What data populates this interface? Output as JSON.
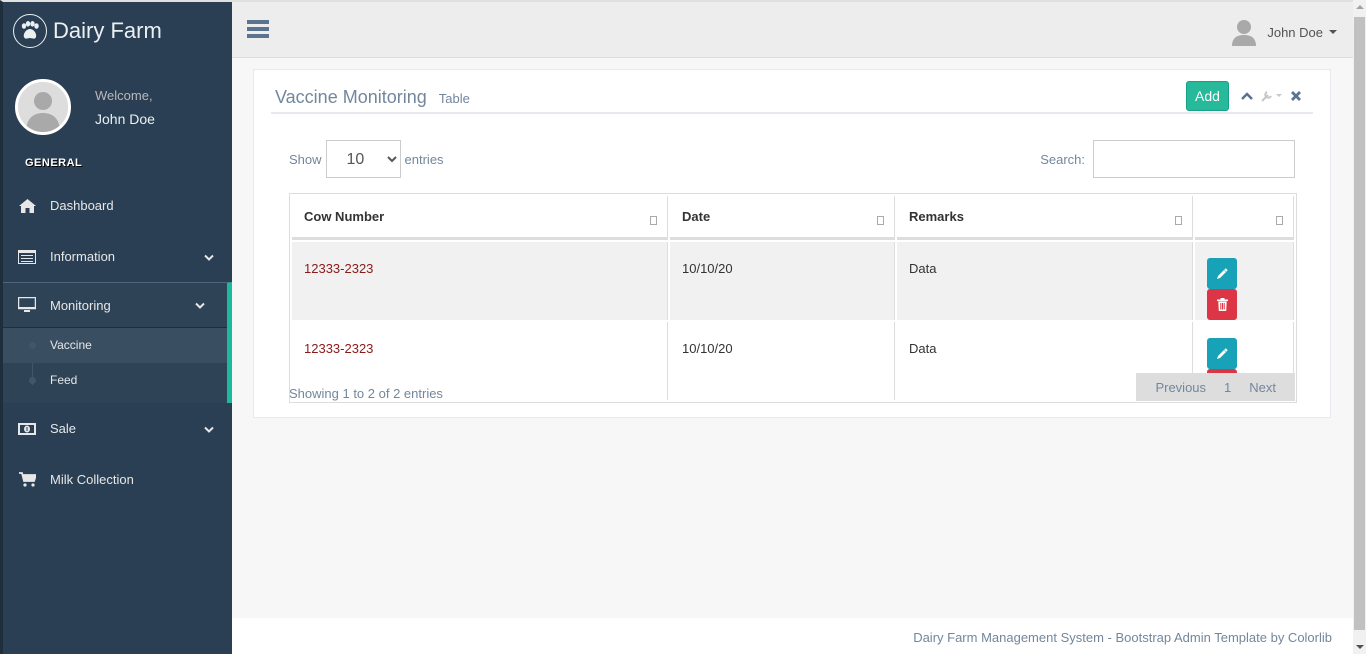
{
  "app": {
    "title": "Dairy Farm",
    "logo_icon": "paw-icon"
  },
  "profile": {
    "welcome": "Welcome,",
    "name": "John Doe"
  },
  "sidebar": {
    "section": "GENERAL",
    "items": [
      {
        "label": "Dashboard",
        "icon": "home-icon"
      },
      {
        "label": "Information",
        "icon": "list-alt-icon",
        "has_children": true
      },
      {
        "label": "Monitoring",
        "icon": "desktop-icon",
        "has_children": true,
        "expanded": true,
        "children": [
          {
            "label": "Vaccine",
            "current": true
          },
          {
            "label": "Feed"
          }
        ]
      },
      {
        "label": "Sale",
        "icon": "money-icon",
        "has_children": true
      },
      {
        "label": "Milk Collection",
        "icon": "shopping-cart-icon"
      }
    ]
  },
  "topnav": {
    "user_name": "John Doe"
  },
  "panel": {
    "title": "Vaccine Monitoring",
    "subtitle": "Table",
    "add_label": "Add"
  },
  "datatable": {
    "show_label": "Show",
    "entries_label": "entries",
    "page_length": "10",
    "search_label": "Search:",
    "search_value": "",
    "columns": [
      "Cow Number",
      "Date",
      "Remarks",
      ""
    ],
    "rows": [
      {
        "cow_number": "12333-2323",
        "date": "10/10/20",
        "remarks": "Data"
      },
      {
        "cow_number": "12333-2323",
        "date": "10/10/20",
        "remarks": "Data"
      }
    ],
    "info": "Showing 1 to 2 of 2 entries",
    "pagination": {
      "previous": "Previous",
      "page": "1",
      "next": "Next"
    }
  },
  "footer": {
    "text": "Dairy Farm Management System - Bootstrap Admin Template by Colorlib"
  },
  "colors": {
    "sidebar": "#2A3F54",
    "accent": "#1ABB9C",
    "add": "#26B99A",
    "edit": "#17A2B8",
    "delete": "#DC3545",
    "link": "#8B1A1A"
  }
}
